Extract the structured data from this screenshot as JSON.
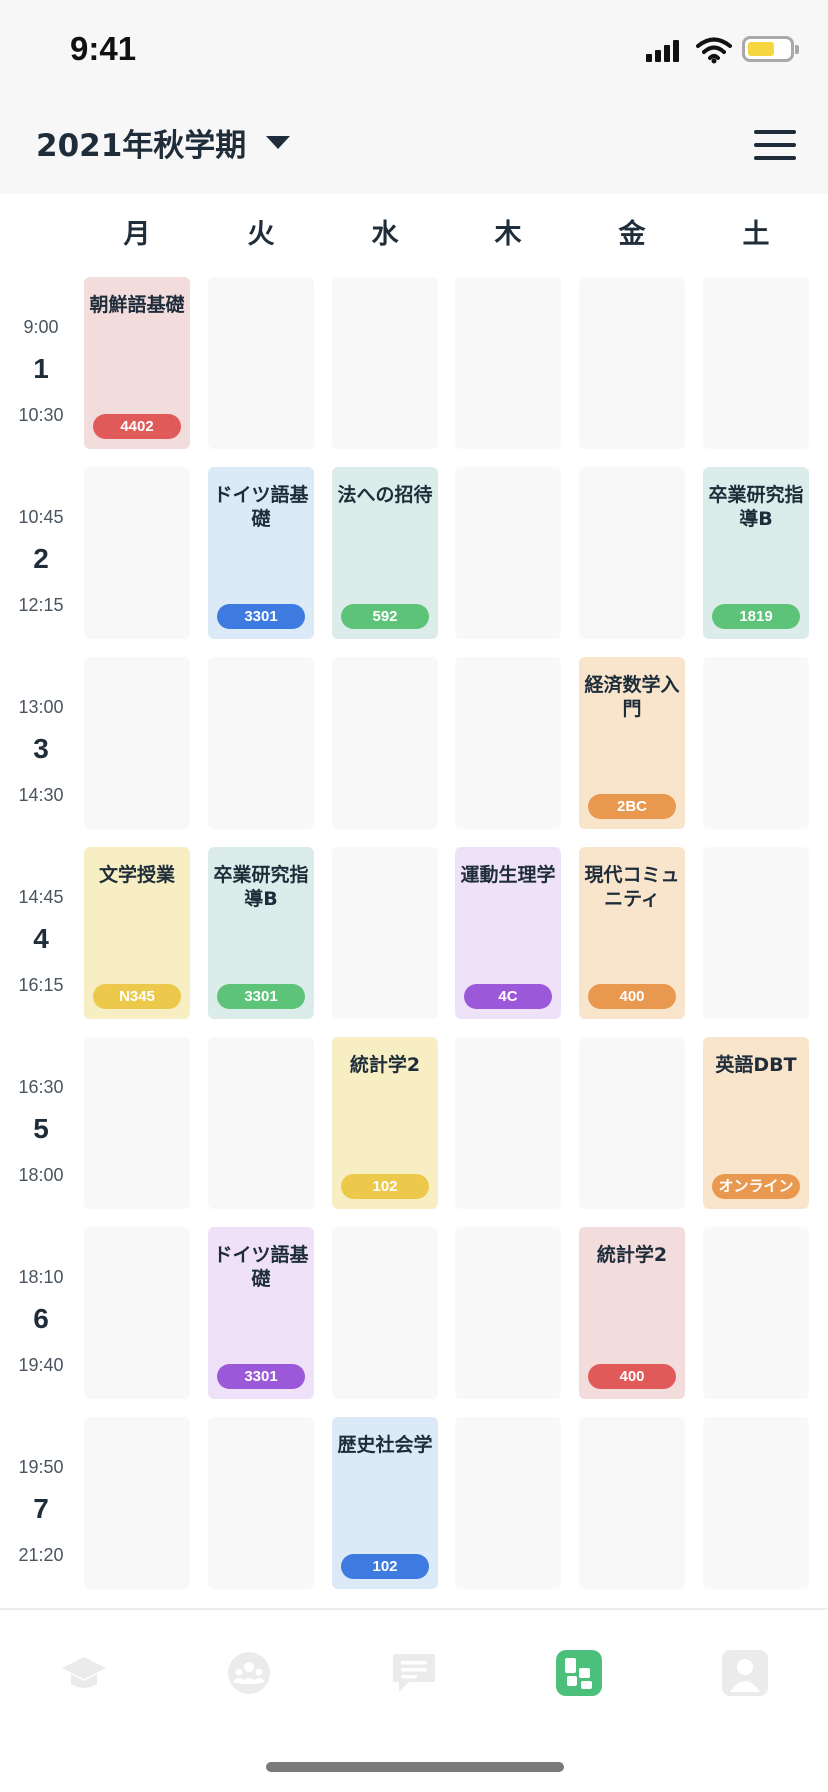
{
  "status_bar": {
    "time": "9:41"
  },
  "header": {
    "term": "2021年秋学期"
  },
  "days": [
    "月",
    "火",
    "水",
    "木",
    "金",
    "土"
  ],
  "periods": [
    {
      "num": "1",
      "start": "9:00",
      "end": "10:30"
    },
    {
      "num": "2",
      "start": "10:45",
      "end": "12:15"
    },
    {
      "num": "3",
      "start": "13:00",
      "end": "14:30"
    },
    {
      "num": "4",
      "start": "14:45",
      "end": "16:15"
    },
    {
      "num": "5",
      "start": "16:30",
      "end": "18:00"
    },
    {
      "num": "6",
      "start": "18:10",
      "end": "19:40"
    },
    {
      "num": "7",
      "start": "19:50",
      "end": "21:20"
    }
  ],
  "colors": {
    "red": {
      "bg": "#f2dcdc",
      "badge": "#e05a5a"
    },
    "blue": {
      "bg": "#dbeaf6",
      "badge": "#3d7be0"
    },
    "teal": {
      "bg": "#dcecea",
      "badge": "#5cc378"
    },
    "orange": {
      "bg": "#f8e5cc",
      "badge": "#e8994f"
    },
    "yellow": {
      "bg": "#f7efc3",
      "badge": "#ecc94b"
    },
    "purple": {
      "bg": "#efe2f8",
      "badge": "#9b59d9"
    },
    "empty": "#f8f8f8",
    "tab_inactive": "#ebebeb",
    "tab_active": "#4cc07a"
  },
  "courses": [
    {
      "period": 1,
      "day": 0,
      "name": "朝鮮語基礎",
      "room": "4402",
      "color": "red"
    },
    {
      "period": 2,
      "day": 1,
      "name": "ドイツ語基礎",
      "room": "3301",
      "color": "blue"
    },
    {
      "period": 2,
      "day": 2,
      "name": "法への招待",
      "room": "592",
      "color": "teal"
    },
    {
      "period": 2,
      "day": 5,
      "name": "卒業研究指導B",
      "room": "1819",
      "color": "teal"
    },
    {
      "period": 3,
      "day": 4,
      "name": "経済数学入門",
      "room": "2BC",
      "color": "orange"
    },
    {
      "period": 4,
      "day": 0,
      "name": "文学授業",
      "room": "N345",
      "color": "yellow"
    },
    {
      "period": 4,
      "day": 1,
      "name": "卒業研究指導B",
      "room": "3301",
      "color": "teal"
    },
    {
      "period": 4,
      "day": 3,
      "name": "運動生理学",
      "room": "4C",
      "color": "purple"
    },
    {
      "period": 4,
      "day": 4,
      "name": "現代コミュニティ",
      "room": "400",
      "color": "orange"
    },
    {
      "period": 5,
      "day": 2,
      "name": "統計学2",
      "room": "102",
      "color": "yellow"
    },
    {
      "period": 5,
      "day": 5,
      "name": "英語DBT",
      "room": "オンライン",
      "color": "orange"
    },
    {
      "period": 6,
      "day": 1,
      "name": "ドイツ語基礎",
      "room": "3301",
      "color": "purple"
    },
    {
      "period": 6,
      "day": 4,
      "name": "統計学2",
      "room": "400",
      "color": "red"
    },
    {
      "period": 7,
      "day": 2,
      "name": "歴史社会学",
      "room": "102",
      "color": "blue"
    }
  ],
  "tabs": [
    {
      "icon": "graduation-cap-icon",
      "active": false
    },
    {
      "icon": "community-icon",
      "active": false
    },
    {
      "icon": "chat-icon",
      "active": false
    },
    {
      "icon": "timetable-icon",
      "active": true
    },
    {
      "icon": "profile-icon",
      "active": false
    }
  ]
}
